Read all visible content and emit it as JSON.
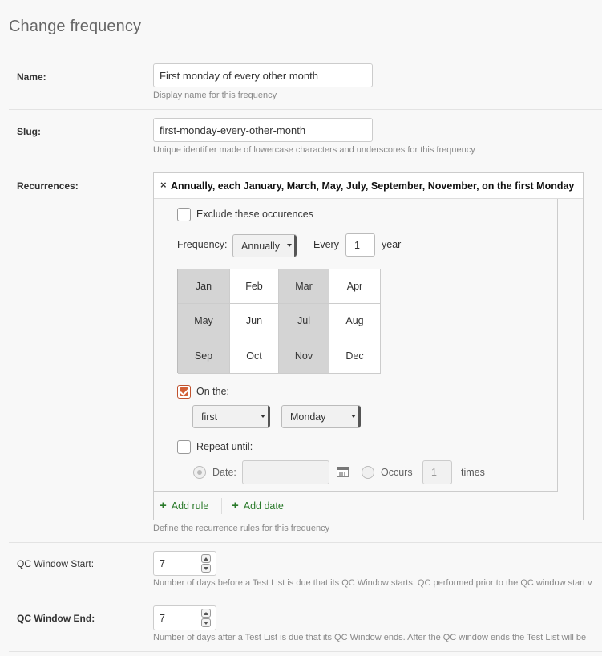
{
  "page": {
    "title": "Change frequency"
  },
  "name_field": {
    "label": "Name:",
    "value": "First monday of every other month",
    "help": "Display name for this frequency"
  },
  "slug_field": {
    "label": "Slug:",
    "value": "first-monday-every-other-month",
    "help": "Unique identifier made of lowercase characters and underscores for this frequency"
  },
  "recurrences": {
    "label": "Recurrences:",
    "remove_glyph": "×",
    "summary": "Annually, each January, March, May, July, September, November, on the first Monday",
    "exclude_label": "Exclude these occurences",
    "frequency_label": "Frequency:",
    "frequency_value": "Annually",
    "every_label": "Every",
    "every_value": "1",
    "unit_label": "year",
    "months": [
      {
        "label": "Jan",
        "selected": true
      },
      {
        "label": "Feb",
        "selected": false
      },
      {
        "label": "Mar",
        "selected": true
      },
      {
        "label": "Apr",
        "selected": false
      },
      {
        "label": "May",
        "selected": true
      },
      {
        "label": "Jun",
        "selected": false
      },
      {
        "label": "Jul",
        "selected": true
      },
      {
        "label": "Aug",
        "selected": false
      },
      {
        "label": "Sep",
        "selected": true
      },
      {
        "label": "Oct",
        "selected": false
      },
      {
        "label": "Nov",
        "selected": true
      },
      {
        "label": "Dec",
        "selected": false
      }
    ],
    "on_the_label": "On the:",
    "on_the_checked": true,
    "position_value": "first",
    "weekday_value": "Monday",
    "repeat_until_label": "Repeat until:",
    "date_label": "Date:",
    "occurs_label": "Occurs",
    "occurs_value": "1",
    "times_label": "times",
    "add_rule_label": "Add rule",
    "add_date_label": "Add date",
    "plus_glyph": "+",
    "help": "Define the recurrence rules for this frequency"
  },
  "qc_window_start": {
    "label": "QC Window Start:",
    "value": "7",
    "help": "Number of days before a Test List is due that its QC Window starts. QC performed prior to the QC window start v"
  },
  "qc_window_end": {
    "label": "QC Window End:",
    "value": "7",
    "help": "Number of days after a Test List is due that its QC Window ends. After the QC window ends the Test List will be"
  },
  "colors": {
    "accent_check": "#d35f36",
    "link_green": "#2a7a2a",
    "selected_month": "#d4d4d4"
  }
}
